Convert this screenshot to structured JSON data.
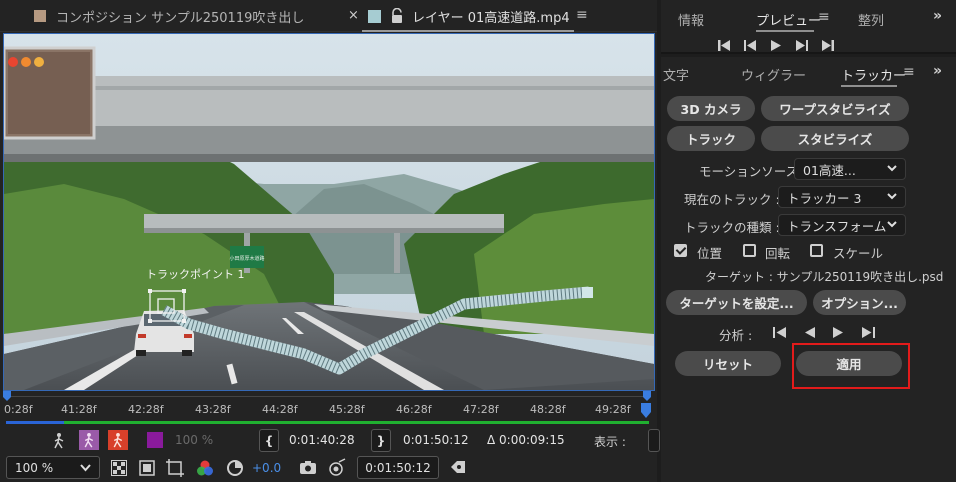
{
  "left_panel": {
    "comp_tab": {
      "label": "コンポジション サンプル250119吹き出し",
      "swatch_color": "#b69a82",
      "close": "×"
    },
    "layer_tab": {
      "label": "レイヤー 01高速道路.mp4",
      "swatch_color": "#a6ccd2",
      "menu": "≡"
    },
    "viewer": {
      "track_point_label": "トラックポイント 1",
      "sign_text": "小田原厚木道路"
    },
    "ruler": {
      "ticks": [
        "0:28f",
        "41:28f",
        "42:28f",
        "43:28f",
        "44:28f",
        "45:28f",
        "46:28f",
        "47:28f",
        "48:28f",
        "49:28f"
      ],
      "progress_fraction": 0.09
    },
    "controls_row1": {
      "opacity": "100 %",
      "in_point": "0:01:40:28",
      "out_point": "0:01:50:12",
      "duration": "Δ 0:00:09:15",
      "view_label": "表示 :"
    },
    "controls_row2": {
      "zoom": "100 %",
      "exposure": "+0.0",
      "current_time": "0:01:50:12"
    }
  },
  "right_top": {
    "tabs": [
      {
        "label": "情報",
        "active": false
      },
      {
        "label": "プレビュー",
        "active": true
      },
      {
        "label": "整列",
        "active": false
      }
    ],
    "menu": "≡",
    "more": "»",
    "transport_icons": [
      "first-frame-icon",
      "prev-frame-icon",
      "play-icon",
      "next-frame-icon",
      "last-frame-icon"
    ]
  },
  "right_main": {
    "tabs": [
      {
        "label": "文字",
        "active": false
      },
      {
        "label": "ウィグラー",
        "active": false
      },
      {
        "label": "トラッカー",
        "active": true
      }
    ],
    "menu": "≡",
    "more": "»",
    "buttons": {
      "camera_3d": "3D カメラ",
      "warp_stabilize": "ワープスタビライズ",
      "track": "トラック",
      "stabilize": "スタビライズ",
      "set_target": "ターゲットを設定...",
      "options": "オプション...",
      "reset": "リセット",
      "apply": "適用"
    },
    "motion_source": {
      "label": "モーションソース :",
      "value": "01高速..."
    },
    "current_track": {
      "label": "現在のトラック :",
      "value": "トラッカー 3"
    },
    "track_type": {
      "label": "トラックの種類 :",
      "value": "トランスフォーム"
    },
    "checkboxes": [
      {
        "label": "位置",
        "checked": true
      },
      {
        "label": "回転",
        "checked": false
      },
      {
        "label": "スケール",
        "checked": false
      }
    ],
    "target": "ターゲット : サンプル250119吹き出し.psd",
    "analyze_label": "分析 :",
    "highlight_color": "#e21b1b"
  }
}
